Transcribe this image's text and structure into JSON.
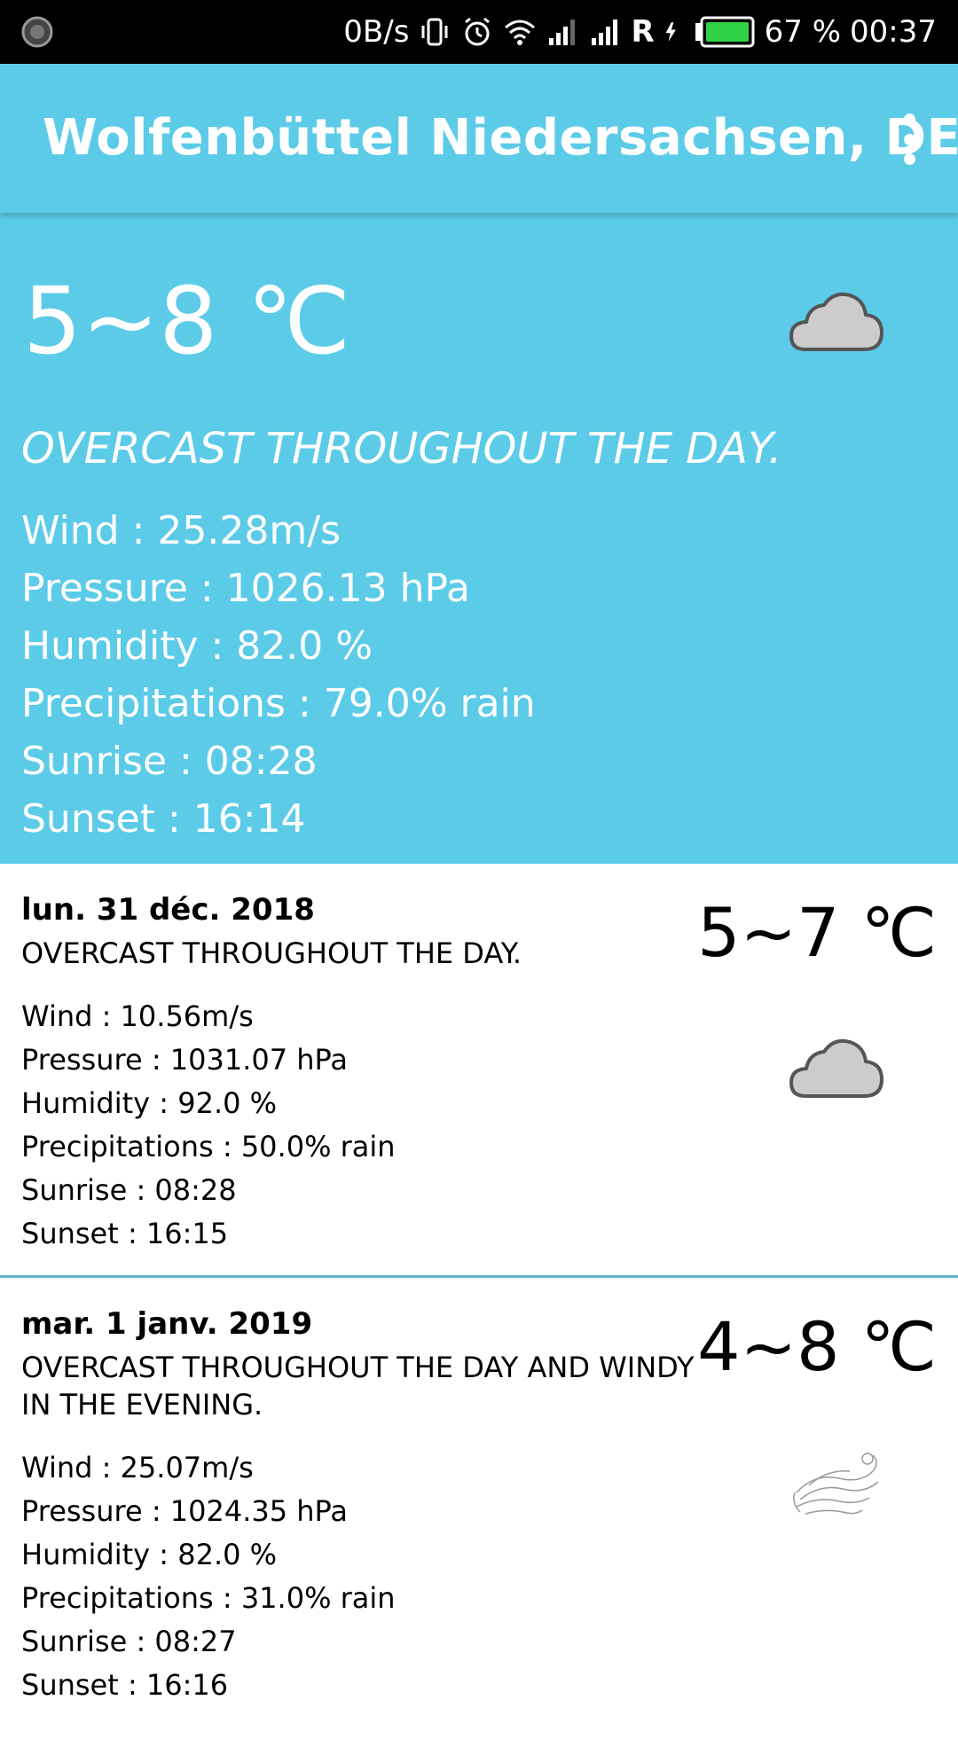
{
  "status_bar": {
    "net_speed": "0B/s",
    "battery": "67 %",
    "time": "00:37",
    "roaming": "R"
  },
  "toolbar": {
    "title": "Wolfenbüttel Niedersachsen, DE"
  },
  "today": {
    "temperature": "5~8 ℃",
    "description": "OVERCAST THROUGHOUT THE DAY.",
    "icon": "cloud-icon",
    "wind": "Wind : 25.28m/s",
    "pressure": "Pressure : 1026.13 hPa",
    "humidity": "Humidity : 82.0 %",
    "precipitations": "Precipitations : 79.0% rain",
    "sunrise": "Sunrise : 08:28",
    "sunset": "Sunset : 16:14"
  },
  "forecast": [
    {
      "date": "lun. 31 déc. 2018",
      "description": "OVERCAST THROUGHOUT THE DAY.",
      "temperature": "5~7 ℃",
      "icon": "cloud-icon",
      "wind": "Wind : 10.56m/s",
      "pressure": "Pressure : 1031.07 hPa",
      "humidity": "Humidity : 92.0 %",
      "precipitations": "Precipitations : 50.0% rain",
      "sunrise": "Sunrise : 08:28",
      "sunset": "Sunset : 16:15"
    },
    {
      "date": "mar. 1 janv. 2019",
      "description": "OVERCAST THROUGHOUT THE DAY AND WINDY IN THE EVENING.",
      "temperature": "4~8 ℃",
      "icon": "wind-icon",
      "wind": "Wind : 25.07m/s",
      "pressure": "Pressure : 1024.35 hPa",
      "humidity": "Humidity : 82.0 %",
      "precipitations": "Precipitations : 31.0% rain",
      "sunrise": "Sunrise : 08:27",
      "sunset": "Sunset : 16:16"
    }
  ],
  "colors": {
    "primary": "#5bcbe8",
    "divider": "#62b3c7",
    "cloud_fill": "#cccccc",
    "cloud_stroke": "#555555"
  }
}
